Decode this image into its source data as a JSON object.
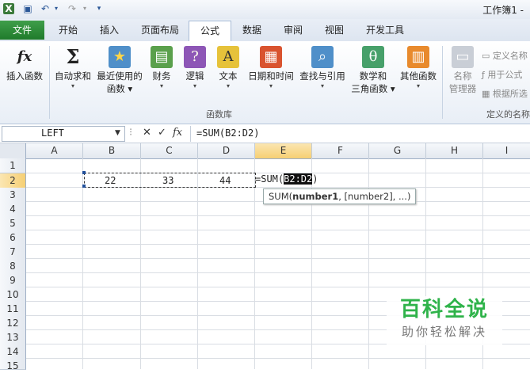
{
  "window": {
    "title": "工作簿1 -"
  },
  "quick_access": {
    "icons": [
      "save-icon",
      "undo-icon",
      "redo-icon",
      "customize-icon"
    ]
  },
  "tabs": [
    {
      "label": "文件"
    },
    {
      "label": "开始"
    },
    {
      "label": "插入"
    },
    {
      "label": "页面布局"
    },
    {
      "label": "公式"
    },
    {
      "label": "数据"
    },
    {
      "label": "审阅"
    },
    {
      "label": "视图"
    },
    {
      "label": "开发工具"
    }
  ],
  "ribbon": {
    "buttons": [
      {
        "label": "插入函数",
        "label2": "",
        "icon": "fx"
      },
      {
        "label": "自动求和",
        "label2": "",
        "icon": "Σ"
      },
      {
        "label": "最近使用的",
        "label2": "函数",
        "icon": "★"
      },
      {
        "label": "财务",
        "label2": "",
        "icon": "▤"
      },
      {
        "label": "逻辑",
        "label2": "",
        "icon": "?"
      },
      {
        "label": "文本",
        "label2": "",
        "icon": "A"
      },
      {
        "label": "日期和时间",
        "label2": "",
        "icon": "▦"
      },
      {
        "label": "查找与引用",
        "label2": "",
        "icon": "⌕"
      },
      {
        "label": "数学和",
        "label2": "三角函数",
        "icon": "θ"
      },
      {
        "label": "其他函数",
        "label2": "",
        "icon": "▥"
      }
    ],
    "group_label": "函数库",
    "names": {
      "manager_line1": "名称",
      "manager_line2": "管理器",
      "define": "定义名称",
      "use": "用于公式",
      "create": "根据所选",
      "group_label": "定义的名称"
    }
  },
  "formula_bar": {
    "name_box": "LEFT",
    "formula": "=SUM(B2:D2)",
    "fx": "fx"
  },
  "grid": {
    "columns": [
      "A",
      "B",
      "C",
      "D",
      "E",
      "F",
      "G",
      "H",
      "I"
    ],
    "rows": [
      "1",
      "2",
      "3",
      "4",
      "5",
      "6",
      "7",
      "8",
      "9",
      "10",
      "11",
      "12",
      "13",
      "14",
      "15"
    ],
    "cells": {
      "B2": "22",
      "C2": "33",
      "D2": "44"
    },
    "edit": {
      "prefix": "=SUM(",
      "highlight": "B2:D2",
      "suffix": ")"
    }
  },
  "tooltip": {
    "fn": "SUM(",
    "arg1": "number1",
    "rest": ", [number2], ...)"
  },
  "watermark": {
    "title": "百科全说",
    "sub": "助你轻松解决"
  }
}
